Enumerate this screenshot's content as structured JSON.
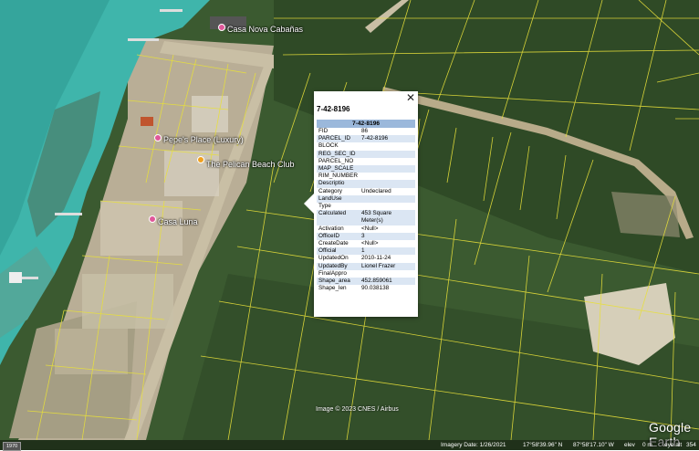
{
  "popup": {
    "title": "7-42-8196",
    "table_header": "7-42-8196",
    "close_icon": "close-icon",
    "rows": [
      {
        "key": "FID",
        "value": "86"
      },
      {
        "key": "PARCEL_ID",
        "value": "7-42-8196"
      },
      {
        "key": "BLOCK",
        "value": ""
      },
      {
        "key": "REG_SEC_ID",
        "value": ""
      },
      {
        "key": "PARCEL_NO",
        "value": ""
      },
      {
        "key": "MAP_SCALE",
        "value": ""
      },
      {
        "key": "RIM_NUMBER",
        "value": ""
      },
      {
        "key": "Descriptio",
        "value": ""
      },
      {
        "key": "Category",
        "value": "Undeclared"
      },
      {
        "key": "LandUse",
        "value": ""
      },
      {
        "key": "Type",
        "value": ""
      },
      {
        "key": "Calculated",
        "value": "453 Square Meter(s)"
      },
      {
        "key": "Activation",
        "value": "<Null>"
      },
      {
        "key": "OfficeID",
        "value": "3"
      },
      {
        "key": "CreateDate",
        "value": "<Null>"
      },
      {
        "key": "Official",
        "value": "1"
      },
      {
        "key": "UpdatedOn",
        "value": "2010-11-24"
      },
      {
        "key": "UpdatedBy",
        "value": "Lionel Frazer"
      },
      {
        "key": "FinalAppro",
        "value": ""
      },
      {
        "key": "Shape_area",
        "value": "452.859061"
      },
      {
        "key": "Shape_len",
        "value": "90.038138"
      }
    ]
  },
  "places": [
    {
      "label": "Casa Nova Cabañas",
      "color": "pink"
    },
    {
      "label": "Pepe's Place (Luxury)",
      "color": "pink"
    },
    {
      "label": "The Pelican Beach Club",
      "color": "orange"
    },
    {
      "label": "Casa Luna",
      "color": "pink"
    }
  ],
  "map": {
    "copyright": "Image © 2023 CNES / Airbus",
    "logo": "Google Earth"
  },
  "footer": {
    "year": "1970",
    "imagery_date": "Imagery Date: 1/26/2021",
    "lat": "17°58'39.96\" N",
    "lon": "87°58'17.10\" W",
    "elev": "elev",
    "elev_value": "0 m",
    "eye_alt": "eye alt",
    "eye_alt_value": "354"
  },
  "colors": {
    "sea": "#3fb5ab",
    "vegetation": "#3a5a2e",
    "parcel_lines": "#e8e03a",
    "road": "#c9bfa5",
    "table_header": "#9bb8db",
    "row_alt": "#dbe6f3"
  }
}
